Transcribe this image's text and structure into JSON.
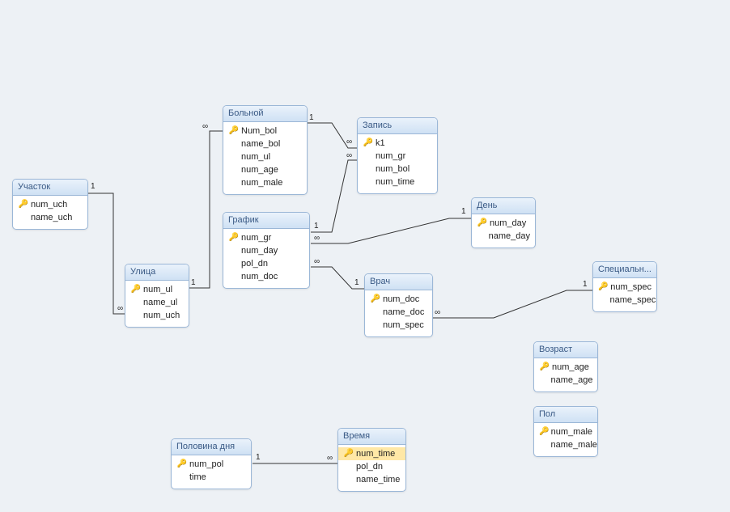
{
  "tables": {
    "uchastok": {
      "title": "Участок",
      "fields": [
        {
          "name": "num_uch",
          "pk": true
        },
        {
          "name": "name_uch",
          "pk": false
        }
      ]
    },
    "ulica": {
      "title": "Улица",
      "fields": [
        {
          "name": "num_ul",
          "pk": true
        },
        {
          "name": "name_ul",
          "pk": false
        },
        {
          "name": "num_uch",
          "pk": false
        }
      ]
    },
    "bolnoy": {
      "title": "Больной",
      "fields": [
        {
          "name": "Num_bol",
          "pk": true
        },
        {
          "name": "name_bol",
          "pk": false
        },
        {
          "name": "num_ul",
          "pk": false
        },
        {
          "name": "num_age",
          "pk": false
        },
        {
          "name": "num_male",
          "pk": false
        }
      ]
    },
    "zapis": {
      "title": "Запись",
      "fields": [
        {
          "name": "k1",
          "pk": true
        },
        {
          "name": "num_gr",
          "pk": false
        },
        {
          "name": "num_bol",
          "pk": false
        },
        {
          "name": "num_time",
          "pk": false
        }
      ]
    },
    "grafik": {
      "title": "График",
      "fields": [
        {
          "name": "num_gr",
          "pk": true
        },
        {
          "name": "num_day",
          "pk": false
        },
        {
          "name": "pol_dn",
          "pk": false
        },
        {
          "name": "num_doc",
          "pk": false
        }
      ]
    },
    "den": {
      "title": "День",
      "fields": [
        {
          "name": "num_day",
          "pk": true
        },
        {
          "name": "name_day",
          "pk": false
        }
      ]
    },
    "vrach": {
      "title": "Врач",
      "fields": [
        {
          "name": "num_doc",
          "pk": true
        },
        {
          "name": "name_doc",
          "pk": false
        },
        {
          "name": "num_spec",
          "pk": false
        }
      ]
    },
    "special": {
      "title": "Специальн...",
      "fields": [
        {
          "name": "num_spec",
          "pk": true
        },
        {
          "name": "name_spec",
          "pk": false
        }
      ]
    },
    "vozrast": {
      "title": "Возраст",
      "fields": [
        {
          "name": "num_age",
          "pk": true
        },
        {
          "name": "name_age",
          "pk": false
        }
      ]
    },
    "pol": {
      "title": "Пол",
      "fields": [
        {
          "name": "num_male",
          "pk": true
        },
        {
          "name": "name_male",
          "pk": false
        }
      ]
    },
    "polovina": {
      "title": "Половина дня",
      "fields": [
        {
          "name": "num_pol",
          "pk": true
        },
        {
          "name": "time",
          "pk": false
        }
      ]
    },
    "vremya": {
      "title": "Время",
      "fields": [
        {
          "name": "num_time",
          "pk": true,
          "selected": true
        },
        {
          "name": "pol_dn",
          "pk": false
        },
        {
          "name": "name_time",
          "pk": false
        }
      ]
    }
  },
  "cardinality": {
    "one": "1",
    "many": "∞"
  },
  "relationships": [
    {
      "from": "uchastok.num_uch",
      "to": "ulica.num_uch",
      "type": "1-∞"
    },
    {
      "from": "ulica.num_ul",
      "to": "bolnoy.num_ul",
      "type": "1-∞"
    },
    {
      "from": "bolnoy.Num_bol",
      "to": "zapis.num_bol",
      "type": "1-∞"
    },
    {
      "from": "grafik.num_gr",
      "to": "zapis.num_gr",
      "type": "1-∞"
    },
    {
      "from": "grafik.num_day",
      "to": "den.num_day",
      "type": "∞-1"
    },
    {
      "from": "grafik.num_doc",
      "to": "vrach.num_doc",
      "type": "∞-1"
    },
    {
      "from": "vrach.num_spec",
      "to": "special.num_spec",
      "type": "∞-1"
    },
    {
      "from": "polovina.num_pol",
      "to": "vremya.pol_dn",
      "type": "1-∞"
    }
  ]
}
